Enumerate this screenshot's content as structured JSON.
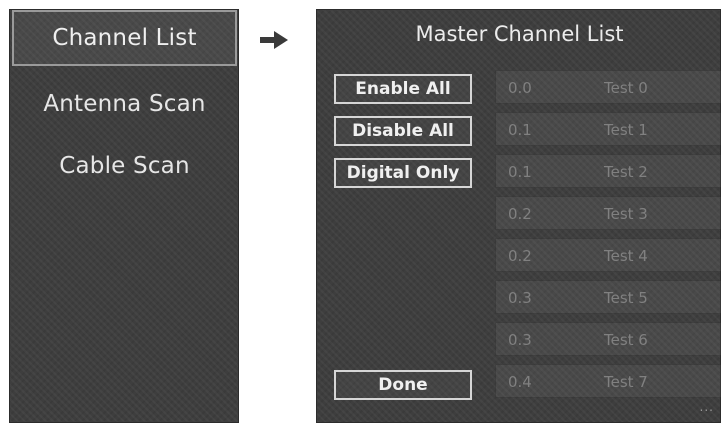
{
  "left_menu": {
    "items": [
      {
        "label": "Channel List",
        "selected": true
      },
      {
        "label": "Antenna Scan",
        "selected": false
      },
      {
        "label": "Cable Scan",
        "selected": false
      }
    ]
  },
  "arrow_icon": "right-arrow-icon",
  "channel_panel": {
    "title": "Master Channel List",
    "buttons": {
      "enable_all": "Enable All",
      "disable_all": "Disable All",
      "digital_only": "Digital Only",
      "done": "Done"
    },
    "channels": [
      {
        "number": "0.0",
        "name": "Test 0"
      },
      {
        "number": "0.1",
        "name": "Test 1"
      },
      {
        "number": "0.1",
        "name": "Test 2"
      },
      {
        "number": "0.2",
        "name": "Test 3"
      },
      {
        "number": "0.2",
        "name": "Test 4"
      },
      {
        "number": "0.3",
        "name": "Test 5"
      },
      {
        "number": "0.3",
        "name": "Test 6"
      },
      {
        "number": "0.4",
        "name": "Test 7"
      }
    ],
    "more_indicator": "..."
  },
  "colors": {
    "panel_bg": "#3e3e3e",
    "text": "#e6e6e6",
    "dim_text": "#808080",
    "button_border": "#d6d6d6"
  }
}
